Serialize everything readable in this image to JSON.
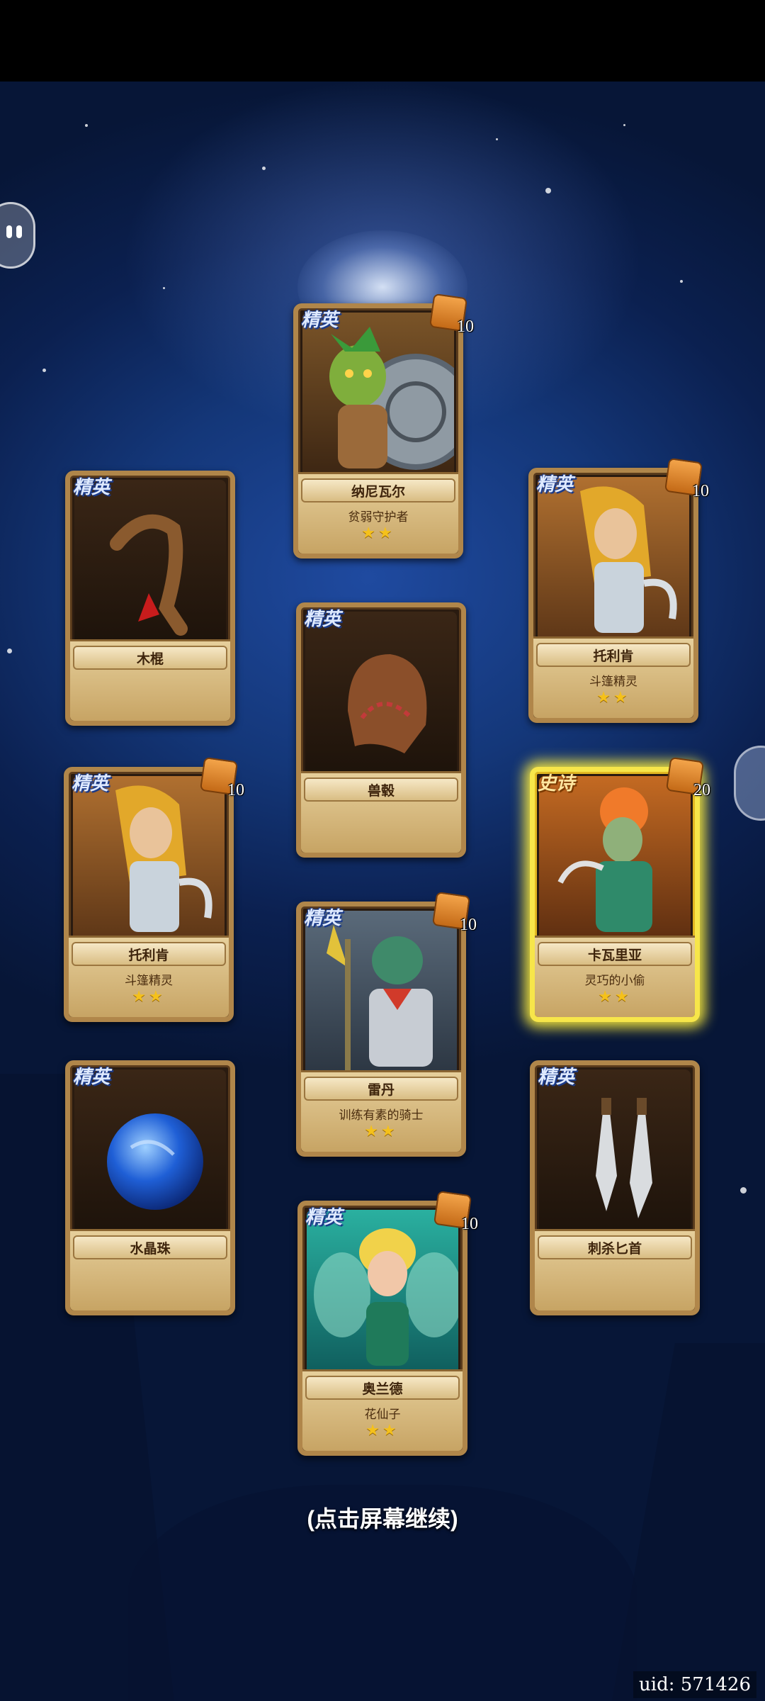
{
  "screen": {
    "continue_hint": "(点击屏幕继续)",
    "uid_label": "uid: 571426"
  },
  "cards": [
    {
      "id": "card-naniwaer",
      "rarity": "精英",
      "name": "纳尼瓦尔",
      "subtitle": "贫弱守护者",
      "stars": "★★",
      "count": "10",
      "art_icon": "goblin-shield-hero-icon",
      "is_hero": true
    },
    {
      "id": "card-mugun",
      "rarity": "精英",
      "name": "木棍",
      "subtitle": "",
      "stars": "",
      "count": "",
      "art_icon": "wooden-stick-icon",
      "is_hero": false
    },
    {
      "id": "card-tuolikan-1",
      "rarity": "精英",
      "name": "托利肯",
      "subtitle": "斗篷精灵",
      "stars": "★★",
      "count": "10",
      "art_icon": "cloaked-elf-hero-icon",
      "is_hero": true
    },
    {
      "id": "card-shouke",
      "rarity": "精英",
      "name": "兽毂",
      "subtitle": "",
      "stars": "",
      "count": "",
      "art_icon": "leather-hood-icon",
      "is_hero": false
    },
    {
      "id": "card-tuolikan-2",
      "rarity": "精英",
      "name": "托利肯",
      "subtitle": "斗篷精灵",
      "stars": "★★",
      "count": "10",
      "art_icon": "cloaked-elf-hero-icon",
      "is_hero": true
    },
    {
      "id": "card-kawaliya",
      "rarity": "史诗",
      "name": "卡瓦里亚",
      "subtitle": "灵巧的小偷",
      "stars": "★★",
      "count": "20",
      "art_icon": "thief-hero-icon",
      "is_hero": true
    },
    {
      "id": "card-leidan",
      "rarity": "精英",
      "name": "雷丹",
      "subtitle": "训练有素的骑士",
      "stars": "★★",
      "count": "10",
      "art_icon": "dragon-knight-hero-icon",
      "is_hero": true
    },
    {
      "id": "card-shuijingzhu",
      "rarity": "精英",
      "name": "水晶珠",
      "subtitle": "",
      "stars": "",
      "count": "",
      "art_icon": "crystal-orb-icon",
      "is_hero": false
    },
    {
      "id": "card-cisha",
      "rarity": "精英",
      "name": "刺杀匕首",
      "subtitle": "",
      "stars": "",
      "count": "",
      "art_icon": "twin-daggers-icon",
      "is_hero": false
    },
    {
      "id": "card-aolande",
      "rarity": "精英",
      "name": "奥兰德",
      "subtitle": "花仙子",
      "stars": "★★",
      "count": "10",
      "art_icon": "flower-fairy-hero-icon",
      "is_hero": true
    }
  ]
}
